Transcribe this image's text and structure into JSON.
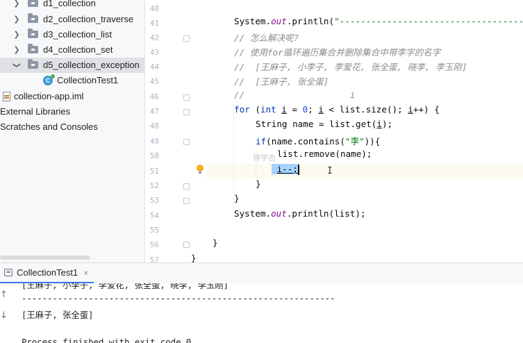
{
  "project_tree": {
    "items": [
      {
        "label": "d1_collection"
      },
      {
        "label": "d2_collection_traverse"
      },
      {
        "label": "d3_collection_list"
      },
      {
        "label": "d4_collection_set"
      },
      {
        "label": "d5_collection_exception"
      },
      {
        "label": "CollectionTest1"
      },
      {
        "label": "collection-app.iml"
      },
      {
        "label": "External Libraries"
      },
      {
        "label": "Scratches and Consoles"
      }
    ]
  },
  "editor": {
    "line_numbers": [
      "40",
      "41",
      "42",
      "43",
      "44",
      "45",
      "46",
      "47",
      "48",
      "49",
      "50",
      "51",
      "52",
      "53",
      "54",
      "55",
      "56",
      "57"
    ],
    "ghost_hint": "排学合",
    "lines": {
      "l41": {
        "indent": "        ",
        "a": "System.",
        "b": "out",
        "c": ".println(",
        "d": "\"-------------------------------------"
      },
      "l42": "// 怎么解决呢?",
      "l43": "// 使用for循环遍历集合并删除集合中带李字的名字",
      "l44": "//  [王麻子, 小李子, 李爱花, 张全蛋, 晓李, 李玉刚]",
      "l45": "//  [王麻子, 张全蛋]",
      "l46": "//                    i",
      "l47": {
        "for": "for",
        "p1": " (",
        "int": "int",
        "sp": " ",
        "i1": "i",
        "eq": " = ",
        "zero": "0",
        "semi": "; ",
        "i2": "i",
        "cond": " < list.size(); ",
        "i3": "i",
        "inc": "++) {"
      },
      "l48": {
        "a": "String name = list.get(",
        "i": "i",
        "b": ");"
      },
      "l49": {
        "if": "if",
        "a": "(name.contains(",
        "s": "\"李\"",
        "b": ")){"
      },
      "l50": "list.remove(name);",
      "l51": "i--;",
      "l52": "}",
      "l53": "}",
      "l54": {
        "a": "System.",
        "b": "out",
        "c": ".println(list);"
      },
      "l56": "}",
      "l57": "}"
    }
  },
  "run_panel": {
    "tab_label": "CollectionTest1",
    "close_glyph": "×",
    "up_arrow": "↑",
    "down_arrow": "↓",
    "console": [
      "[王麻子, 小李子, 李爱花, 张全蛋, 晓李, 李玉刚]",
      "-------------------------------------------------------------",
      "[王麻子, 张全蛋]",
      "",
      "Process finished with exit code 0"
    ]
  },
  "colors": {
    "keyword": "#0033b3",
    "string": "#067d17",
    "number": "#1750eb",
    "comment": "#8c8c8c",
    "field": "#871094",
    "selection": "#a6d2ff"
  }
}
